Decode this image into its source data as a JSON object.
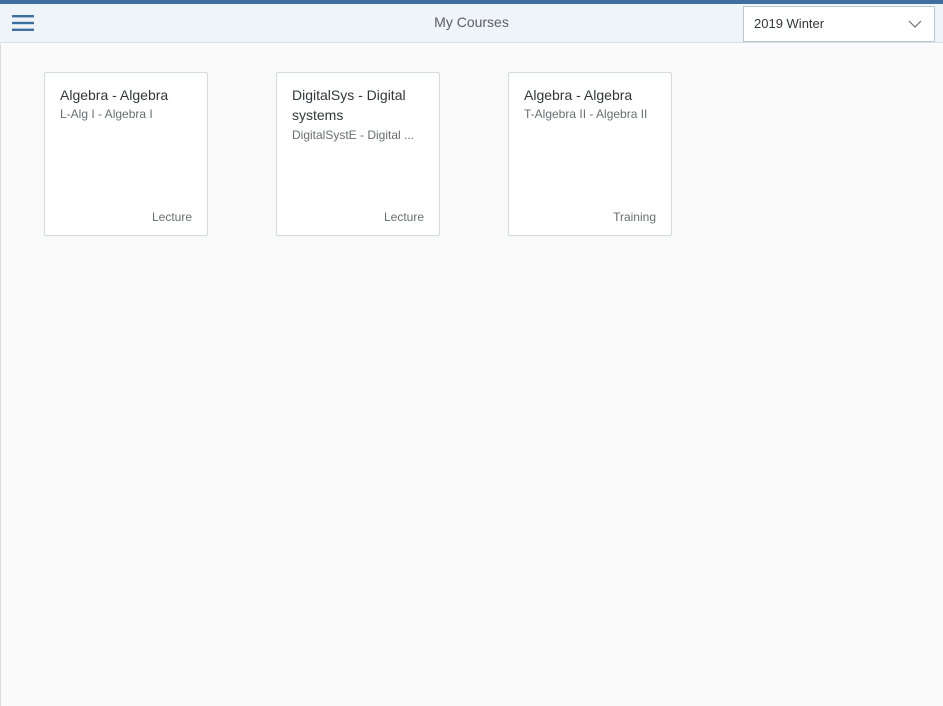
{
  "header": {
    "title": "My Courses",
    "menu_icon": "hamburger-menu-icon",
    "term_select": {
      "value": "2019 Winter",
      "arrow_icon": "chevron-down-icon"
    },
    "accent_color": "#3f6fa0"
  },
  "courses": [
    {
      "title": "Algebra - Algebra",
      "subtitle": "L-Alg I - Algebra I",
      "type": "Lecture"
    },
    {
      "title": "DigitalSys - Digital systems",
      "subtitle": "DigitalSystE - Digital ...",
      "type": "Lecture"
    },
    {
      "title": "Algebra - Algebra",
      "subtitle": "T-Algebra II - Algebra II",
      "type": "Training"
    }
  ]
}
